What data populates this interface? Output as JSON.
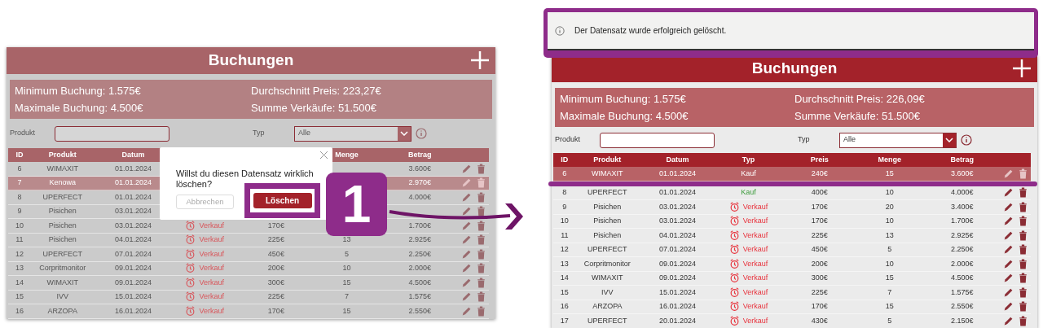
{
  "before": {
    "title": "Buchungen",
    "stats": [
      "Minimum Buchung: 1.575€",
      "Durchschnitt Preis: 223,27€",
      "Maximale Buchung: 4.500€",
      "Summe Verkäufe: 51.500€"
    ],
    "filter": {
      "product_label": "Produkt",
      "type_label": "Typ",
      "type_value": "Alle"
    },
    "columns": [
      "ID",
      "Produkt",
      "Datum",
      null,
      null,
      "Menge",
      "Betrag"
    ],
    "rows": [
      {
        "id": "6",
        "produkt": "WIMAXIT",
        "datum": "01.01.2024",
        "betrag": "3.600€",
        "selected": false
      },
      {
        "id": "7",
        "produkt": "Kenowa",
        "datum": "01.01.2024",
        "betrag": "2.970€",
        "selected": true
      },
      {
        "id": "8",
        "produkt": "UPERFECT",
        "datum": "01.01.2024",
        "betrag": "4.000€",
        "selected": false
      },
      {
        "id": "9",
        "produkt": "Pisichen",
        "datum": "03.01.2024",
        "selected": false
      },
      {
        "id": "10",
        "produkt": "Pisichen",
        "datum": "03.01.2024",
        "typ": {
          "kind": "verkauf",
          "text": "Verkauf"
        },
        "preis": "170€",
        "betrag": "1.700€",
        "selected": false
      },
      {
        "id": "11",
        "produkt": "Pisichen",
        "datum": "04.01.2024",
        "typ": {
          "kind": "verkauf",
          "text": "Verkauf"
        },
        "preis": "225€",
        "menge": "13",
        "betrag": "2.925€",
        "selected": false
      },
      {
        "id": "12",
        "produkt": "UPERFECT",
        "datum": "07.01.2024",
        "typ": {
          "kind": "verkauf",
          "text": "Verkauf"
        },
        "preis": "450€",
        "menge": "5",
        "betrag": "2.250€",
        "selected": false
      },
      {
        "id": "13",
        "produkt": "Corpritmonitor",
        "datum": "09.01.2024",
        "typ": {
          "kind": "verkauf",
          "text": "Verkauf"
        },
        "preis": "200€",
        "menge": "10",
        "betrag": "2.000€",
        "selected": false
      },
      {
        "id": "14",
        "produkt": "WIMAXIT",
        "datum": "09.01.2024",
        "typ": {
          "kind": "verkauf",
          "text": "Verkauf"
        },
        "preis": "300€",
        "menge": "15",
        "betrag": "4.500€",
        "selected": false
      },
      {
        "id": "15",
        "produkt": "IVV",
        "datum": "15.01.2024",
        "typ": {
          "kind": "verkauf",
          "text": "Verkauf"
        },
        "preis": "225€",
        "menge": "7",
        "betrag": "1.575€",
        "selected": false
      },
      {
        "id": "16",
        "produkt": "ARZOPA",
        "datum": "16.01.2024",
        "typ": {
          "kind": "verkauf",
          "text": "Verkauf"
        },
        "preis": "170€",
        "menge": "15",
        "betrag": "2.550€",
        "selected": false
      }
    ],
    "dialog": {
      "message": "Willst du diesen Datensatz wirklich löschen?",
      "cancel": "Abbrechen",
      "confirm": "Löschen"
    }
  },
  "step_badge": "1",
  "after": {
    "toast": "Der Datensatz wurde erfolgreich gelöscht.",
    "title": "Buchungen",
    "stats": [
      "Minimum Buchung: 1.575€",
      "Durchschnitt Preis: 226,09€",
      "Maximale Buchung: 4.500€",
      "Summe Verkäufe: 51.500€"
    ],
    "filter": {
      "product_label": "Produkt",
      "type_label": "Typ",
      "type_value": "Alle"
    },
    "columns": [
      "ID",
      "Produkt",
      "Datum",
      "Typ",
      "Preis",
      "Menge",
      "Betrag"
    ],
    "rows": [
      {
        "id": "6",
        "produkt": "WIMAXIT",
        "datum": "01.01.2024",
        "typ": {
          "kind": "kauf",
          "text": "Kauf"
        },
        "preis": "240€",
        "menge": "15",
        "betrag": "3.600€",
        "selected": true
      },
      {
        "id": "8",
        "produkt": "UPERFECT",
        "datum": "01.01.2024",
        "typ": {
          "kind": "kauf",
          "text": "Kauf"
        },
        "preis": "400€",
        "menge": "10",
        "betrag": "4.000€",
        "selected": false
      },
      {
        "id": "9",
        "produkt": "Pisichen",
        "datum": "03.01.2024",
        "typ": {
          "kind": "verkauf",
          "text": "Verkauf"
        },
        "preis": "170€",
        "menge": "20",
        "betrag": "3.400€",
        "selected": false
      },
      {
        "id": "10",
        "produkt": "Pisichen",
        "datum": "03.01.2024",
        "typ": {
          "kind": "verkauf",
          "text": "Verkauf"
        },
        "preis": "170€",
        "menge": "10",
        "betrag": "1.700€",
        "selected": false
      },
      {
        "id": "11",
        "produkt": "Pisichen",
        "datum": "04.01.2024",
        "typ": {
          "kind": "verkauf",
          "text": "Verkauf"
        },
        "preis": "225€",
        "menge": "13",
        "betrag": "2.925€",
        "selected": false
      },
      {
        "id": "12",
        "produkt": "UPERFECT",
        "datum": "07.01.2024",
        "typ": {
          "kind": "verkauf",
          "text": "Verkauf"
        },
        "preis": "450€",
        "menge": "5",
        "betrag": "2.250€",
        "selected": false
      },
      {
        "id": "13",
        "produkt": "Corpritmonitor",
        "datum": "09.01.2024",
        "typ": {
          "kind": "verkauf",
          "text": "Verkauf"
        },
        "preis": "200€",
        "menge": "10",
        "betrag": "2.000€",
        "selected": false
      },
      {
        "id": "14",
        "produkt": "WIMAXIT",
        "datum": "09.01.2024",
        "typ": {
          "kind": "verkauf",
          "text": "Verkauf"
        },
        "preis": "300€",
        "menge": "15",
        "betrag": "4.500€",
        "selected": false
      },
      {
        "id": "15",
        "produkt": "IVV",
        "datum": "15.01.2024",
        "typ": {
          "kind": "verkauf",
          "text": "Verkauf"
        },
        "preis": "225€",
        "menge": "7",
        "betrag": "1.575€",
        "selected": false
      },
      {
        "id": "16",
        "produkt": "ARZOPA",
        "datum": "16.01.2024",
        "typ": {
          "kind": "verkauf",
          "text": "Verkauf"
        },
        "preis": "170€",
        "menge": "15",
        "betrag": "2.550€",
        "selected": false
      },
      {
        "id": "17",
        "produkt": "UPERFECT",
        "datum": "20.01.2024",
        "typ": {
          "kind": "verkauf",
          "text": "Verkauf"
        },
        "preis": "430€",
        "menge": "5",
        "betrag": "2.150€",
        "selected": false
      }
    ]
  }
}
